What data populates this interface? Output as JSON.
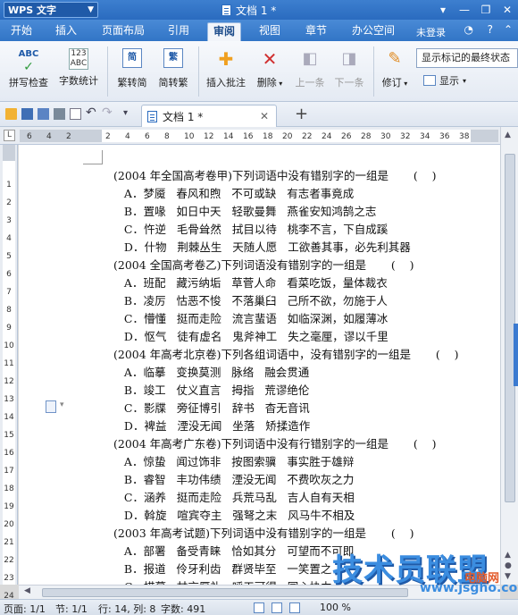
{
  "titlebar": {
    "app": "WPS 文字",
    "doc_title": "文档 1 *"
  },
  "menu": {
    "tabs": [
      "开始",
      "插入",
      "页面布局",
      "引用",
      "审阅",
      "视图",
      "章节",
      "办公空间"
    ],
    "active": "审阅",
    "login": "未登录"
  },
  "ribbon": {
    "spellcheck": "拼写检查",
    "wordcount": "字数统计",
    "to_simplified": "繁转简",
    "to_traditional": "简转繁",
    "insert_comment": "插入批注",
    "delete": "删除",
    "prev": "上一条",
    "next": "下一条",
    "revise": "修订",
    "markup_mode": "显示标记的最终状态",
    "show": "显示",
    "icon_abc": "ABC",
    "icon_123": "123",
    "icon_jian": "简",
    "icon_fan": "繁"
  },
  "doctab": {
    "label": "文档 1 *"
  },
  "ruler": {
    "corner": "L",
    "h_ticks": [
      "6",
      "4",
      "2",
      "",
      "2",
      "4",
      "6",
      "8",
      "10",
      "12",
      "14",
      "16",
      "18",
      "20",
      "22",
      "24",
      "26",
      "28",
      "30",
      "32",
      "34",
      "36",
      "38"
    ],
    "v_ticks": [
      "1",
      "2",
      "3",
      "4",
      "5",
      "6",
      "7",
      "8",
      "9",
      "10",
      "11",
      "12",
      "13",
      "14",
      "15",
      "16",
      "17",
      "18",
      "19",
      "20",
      "21",
      "22",
      "23",
      "24"
    ]
  },
  "document": {
    "lines": [
      "(2004 年全国高考卷甲)下列词语中没有错别字的一组是       (    )",
      "   A．梦魇   春风和煦   不可或缺   有志者事竟成",
      "   B．置喙   如日中天   轻歌曼舞   燕雀安知鸿鹄之志",
      "   C．忤逆   毛骨耸然   拭目以待   桃李不言，下自成蹊",
      "   D．什物   荆棘丛生   天随人愿   工欲善其事，必先利其器",
      "(2004 全国高考卷乙)下列词语没有错别字的一组是       (    )",
      "   A．班配   藏污纳垢   草菅人命   看菜吃饭，量体裁衣",
      "   B．凌厉   怙恶不悛   不落巢臼   己所不欲，勿施于人",
      "   C．懵懂   挺而走险   流言蜚语   如临深渊，如履薄冰",
      "   D．怄气   徒有虚名   鬼斧神工   失之毫厘，谬以千里",
      "(2004 年高考北京卷)下列各组词语中，没有错别字的一组是       (    )",
      "   A．临摹   变换莫测   脉络   融会贯通",
      "   B．竣工   仗义直言   拇指   荒谬绝伦",
      "   C．影牒   旁征博引   辞书   杳无音讯",
      "   D．裨益   湮没无闻   坐落   矫揉造作",
      "(2004 年高考广东卷)下列词语中没有行错别字的一组是       (    )",
      "   A．惊蛰   闻过饰非   按图索骥   事实胜于雄辩",
      "   B．睿智   丰功伟绩   湮没无闻   不费吹灰之力",
      "   C．涵养   挺而走险   兵荒马乱   吉人自有天相",
      "   D．斡旋   喧宾夺主   强弩之末   风马牛不相及",
      "(2003 年高考试题)下列词语中没有错别字的一组是       (    )",
      "   A．部署   备受青睐   恰如其分   可望而不可即",
      "   B．报道   伶牙利齿   群贤毕至   一笑置之",
      "   C．描摹   甘言厚礼   呼天可得   同心协力"
    ]
  },
  "status": {
    "page": "页面: 1/1",
    "section": "节: 1/1",
    "row_col": "行: 14, 列: 8",
    "chars": "字数: 491",
    "zoom": "100 %"
  },
  "watermark": {
    "main": "技术员联盟",
    "url": "www.jsgho.com",
    "small": "电脑网"
  }
}
